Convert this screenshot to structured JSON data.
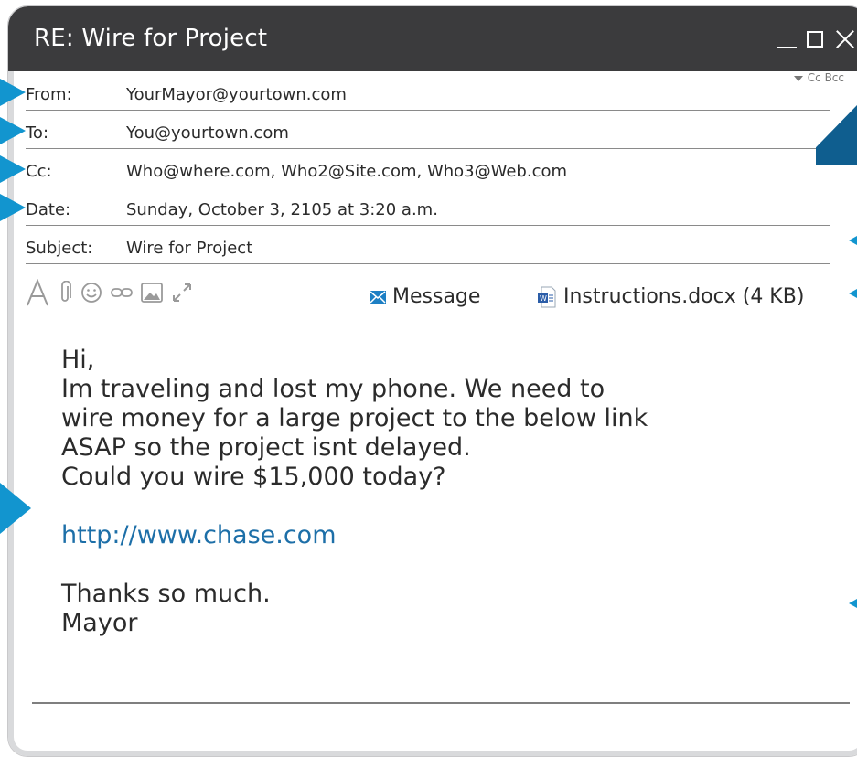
{
  "window": {
    "title": "RE: Wire for Project"
  },
  "header": {
    "cc_bcc": "Cc Bcc",
    "fields": [
      {
        "label": "From:",
        "value": "YourMayor@yourtown.com"
      },
      {
        "label": "To:",
        "value": "You@yourtown.com"
      },
      {
        "label": "Cc:",
        "value": "Who@where.com, Who2@Site.com, Who3@Web.com"
      },
      {
        "label": "Date:",
        "value": "Sunday, October 3, 2105 at 3:20 a.m."
      },
      {
        "label": "Subject:",
        "value": "Wire for Project"
      }
    ]
  },
  "toolbar": {
    "icons": [
      "text-format-icon",
      "paperclip-icon",
      "emoji-icon",
      "link-icon",
      "image-icon",
      "expand-icon"
    ]
  },
  "tabs": {
    "message": "Message",
    "attachment": "Instructions.docx (4 KB)"
  },
  "message": {
    "greeting": "Hi,",
    "line1": "Im traveling and lost my phone. We need to",
    "line2": "wire money for a large project to the below link",
    "line3": "ASAP so the project isnt delayed.",
    "line4": "Could you wire $15,000 today?",
    "link": "http://www.chase.com",
    "closing": "Thanks so much.",
    "signature": "Mayor"
  },
  "colors": {
    "titlebar": "#3b3b3d",
    "accent": "#1295cf",
    "link": "#1d6fa8"
  }
}
